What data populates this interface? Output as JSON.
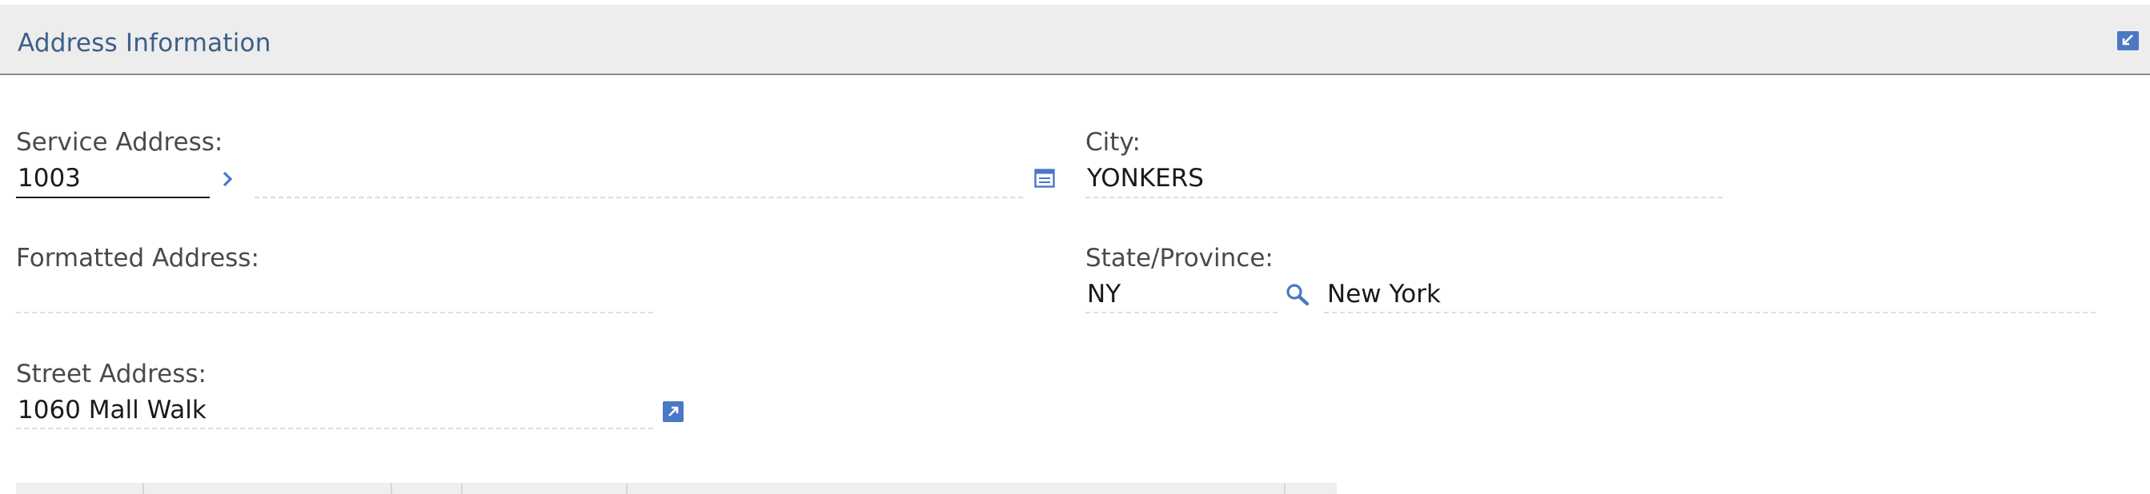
{
  "section": {
    "title": "Address Information"
  },
  "fields": {
    "service_address": {
      "label": "Service Address:",
      "value": "1003",
      "description": ""
    },
    "formatted_address": {
      "label": "Formatted Address:",
      "value": ""
    },
    "street_address": {
      "label": "Street Address:",
      "value": "1060 Mall Walk"
    },
    "city": {
      "label": "City:",
      "value": "YONKERS"
    },
    "state_province": {
      "label": "State/Province:",
      "code": "NY",
      "description": "New York"
    }
  },
  "icons": {
    "collapse": "collapse-section-icon",
    "detail_menu": "chevron-right-icon",
    "long_description": "long-description-icon",
    "lookup": "search-icon",
    "go_to": "go-to-icon"
  },
  "colors": {
    "accent": "#4a78c4",
    "title": "#3c5f86",
    "header_bg": "#ededed"
  }
}
